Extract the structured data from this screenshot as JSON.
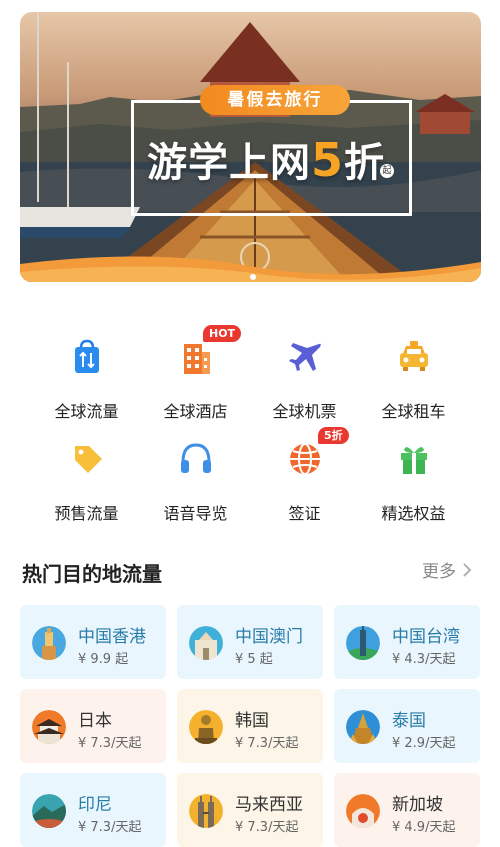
{
  "banner": {
    "pill": "暑假去旅行",
    "title_pre": "游学上网",
    "title_num": "5",
    "title_post": "折",
    "qi": "起"
  },
  "quick": [
    {
      "label": "全球流量",
      "icon": "shopping-bag-icon",
      "badge": ""
    },
    {
      "label": "全球酒店",
      "icon": "hotel-building-icon",
      "badge": "HOT"
    },
    {
      "label": "全球机票",
      "icon": "airplane-icon",
      "badge": ""
    },
    {
      "label": "全球租车",
      "icon": "car-icon",
      "badge": ""
    },
    {
      "label": "预售流量",
      "icon": "price-tag-icon",
      "badge": ""
    },
    {
      "label": "语音导览",
      "icon": "headphones-icon",
      "badge": ""
    },
    {
      "label": "签证",
      "icon": "globe-icon",
      "badge": "5折"
    },
    {
      "label": "精选权益",
      "icon": "gift-icon",
      "badge": ""
    }
  ],
  "section": {
    "title": "热门目的地流量",
    "more": "更多"
  },
  "destinations": [
    {
      "name": "中国香港",
      "price": "¥ 9.9 起"
    },
    {
      "name": "中国澳门",
      "price": "¥ 5 起"
    },
    {
      "name": "中国台湾",
      "price": "¥ 4.3/天起"
    },
    {
      "name": "日本",
      "price": "¥ 7.3/天起"
    },
    {
      "name": "韩国",
      "price": "¥ 7.3/天起"
    },
    {
      "name": "泰国",
      "price": "¥ 2.9/天起"
    },
    {
      "name": "印尼",
      "price": "¥ 7.3/天起"
    },
    {
      "name": "马来西亚",
      "price": "¥ 7.3/天起"
    },
    {
      "name": "新加坡",
      "price": "¥ 4.9/天起"
    }
  ],
  "colors": {
    "accent_orange": "#f28a1f",
    "badge_red": "#e8382f",
    "card_blue": "#eaf6fd",
    "card_orange": "#fdf3ec"
  }
}
